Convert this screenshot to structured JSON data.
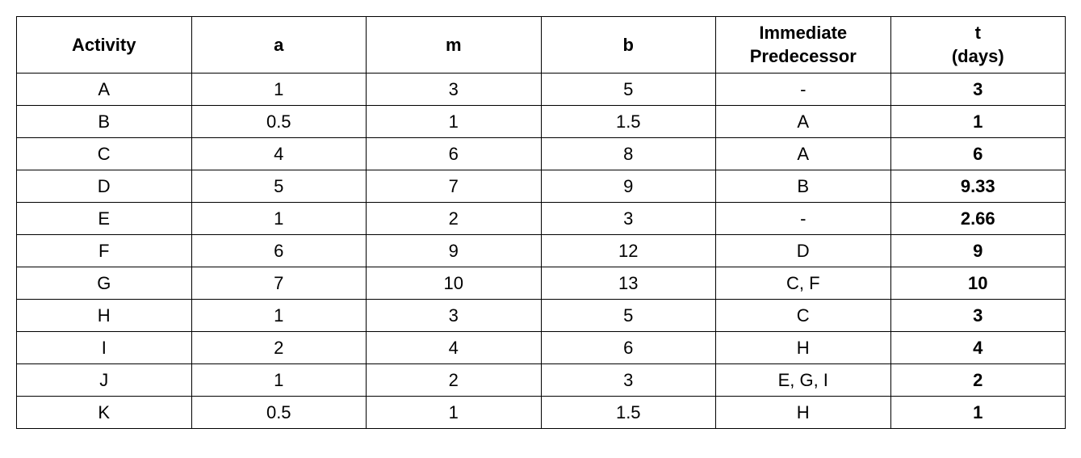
{
  "chart_data": {
    "type": "table",
    "headers": {
      "activity": "Activity",
      "a": "a",
      "m": "m",
      "b": "b",
      "predecessor_line1": "Immediate",
      "predecessor_line2": "Predecessor",
      "t_line1": "t",
      "t_line2": "(days)"
    },
    "rows": [
      {
        "activity": "A",
        "a": "1",
        "m": "3",
        "b": "5",
        "predecessor": "-",
        "t": "3"
      },
      {
        "activity": "B",
        "a": "0.5",
        "m": "1",
        "b": "1.5",
        "predecessor": "A",
        "t": "1"
      },
      {
        "activity": "C",
        "a": "4",
        "m": "6",
        "b": "8",
        "predecessor": "A",
        "t": "6"
      },
      {
        "activity": "D",
        "a": "5",
        "m": "7",
        "b": "9",
        "predecessor": "B",
        "t": "9.33"
      },
      {
        "activity": "E",
        "a": "1",
        "m": "2",
        "b": "3",
        "predecessor": "-",
        "t": "2.66"
      },
      {
        "activity": "F",
        "a": "6",
        "m": "9",
        "b": "12",
        "predecessor": "D",
        "t": "9"
      },
      {
        "activity": "G",
        "a": "7",
        "m": "10",
        "b": "13",
        "predecessor": "C, F",
        "t": "10"
      },
      {
        "activity": "H",
        "a": "1",
        "m": "3",
        "b": "5",
        "predecessor": "C",
        "t": "3"
      },
      {
        "activity": "I",
        "a": "2",
        "m": "4",
        "b": "6",
        "predecessor": "H",
        "t": "4"
      },
      {
        "activity": "J",
        "a": "1",
        "m": "2",
        "b": "3",
        "predecessor": "E, G, I",
        "t": "2"
      },
      {
        "activity": "K",
        "a": "0.5",
        "m": "1",
        "b": "1.5",
        "predecessor": "H",
        "t": "1"
      }
    ]
  }
}
